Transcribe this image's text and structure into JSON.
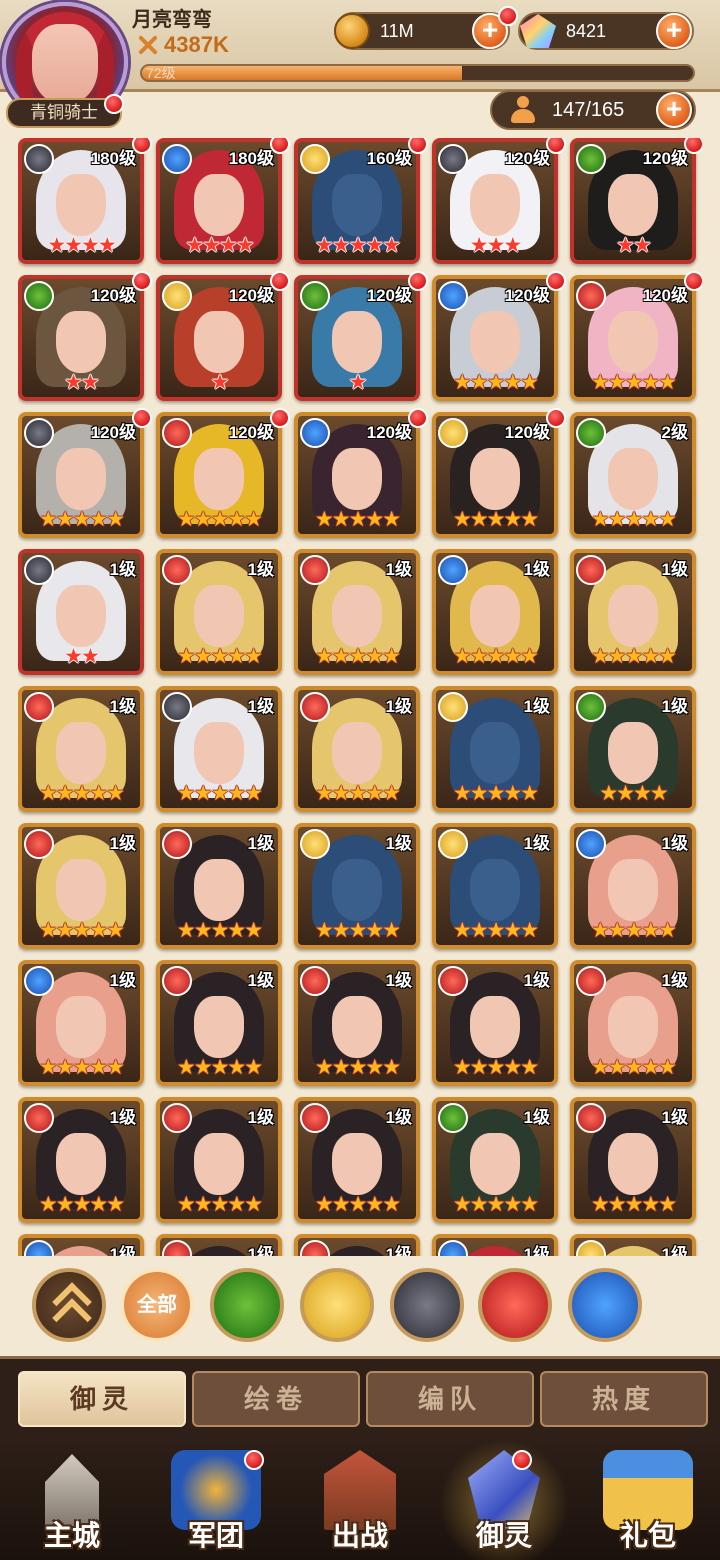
{
  "player": {
    "name": "月亮弯弯",
    "power": "4387K",
    "level_text": "72级",
    "level_progress": 0.58,
    "rank": "青铜骑士"
  },
  "resources": {
    "gold": "11M",
    "gems": "8421",
    "roster": "147/165"
  },
  "heroes": [
    {
      "level": "180级",
      "element": "dark",
      "stars": 4,
      "frame": "red",
      "hair": "#e8e4ec",
      "dot": true
    },
    {
      "level": "180级",
      "element": "water",
      "stars": 4,
      "frame": "red",
      "hair": "#c02835",
      "dot": true
    },
    {
      "level": "160级",
      "element": "holy",
      "stars": 5,
      "frame": "red",
      "hair": "#2c4d78",
      "dot": true
    },
    {
      "level": "120级",
      "element": "dark",
      "stars": 3,
      "frame": "red",
      "hair": "#f2f2f6",
      "dot": true
    },
    {
      "level": "120级",
      "element": "wind",
      "stars": 2,
      "frame": "red",
      "hair": "#1f1c1c",
      "dot": true
    },
    {
      "level": "120级",
      "element": "wind",
      "stars": 2,
      "frame": "red",
      "hair": "#6c5640",
      "dot": true
    },
    {
      "level": "120级",
      "element": "holy",
      "stars": 1,
      "frame": "red",
      "hair": "#b8402a",
      "dot": true
    },
    {
      "level": "120级",
      "element": "wind",
      "stars": 1,
      "frame": "red",
      "hair": "#3a7aa8",
      "dot": true
    },
    {
      "level": "120级",
      "element": "water",
      "stars": 5,
      "frame": "gold",
      "hair": "#c8ccd4",
      "dot": true
    },
    {
      "level": "120级",
      "element": "fire",
      "stars": 5,
      "frame": "gold",
      "hair": "#f0b4c4",
      "dot": true
    },
    {
      "level": "120级",
      "element": "dark",
      "stars": 5,
      "frame": "gold",
      "hair": "#b4b0ac",
      "dot": true
    },
    {
      "level": "120级",
      "element": "fire",
      "stars": 5,
      "frame": "gold",
      "hair": "#e6b828",
      "dot": true
    },
    {
      "level": "120级",
      "element": "water",
      "stars": 5,
      "frame": "gold",
      "hair": "#3a2430",
      "dot": true
    },
    {
      "level": "120级",
      "element": "holy",
      "stars": 5,
      "frame": "gold",
      "hair": "#2a2220",
      "dot": true
    },
    {
      "level": "2级",
      "element": "wind",
      "stars": 5,
      "frame": "gold",
      "hair": "#e4e4e8",
      "dot": false
    },
    {
      "level": "1级",
      "element": "dark",
      "stars": 2,
      "frame": "red",
      "hair": "#e8e8ec",
      "dot": false
    },
    {
      "level": "1级",
      "element": "fire",
      "stars": 5,
      "frame": "gold",
      "hair": "#e6c66c",
      "dot": false
    },
    {
      "level": "1级",
      "element": "fire",
      "stars": 5,
      "frame": "gold",
      "hair": "#e6c66c",
      "dot": false
    },
    {
      "level": "1级",
      "element": "water",
      "stars": 5,
      "frame": "gold",
      "hair": "#e0b84c",
      "dot": false
    },
    {
      "level": "1级",
      "element": "fire",
      "stars": 5,
      "frame": "gold",
      "hair": "#e6c66c",
      "dot": false
    },
    {
      "level": "1级",
      "element": "fire",
      "stars": 5,
      "frame": "gold",
      "hair": "#e6c66c",
      "dot": false
    },
    {
      "level": "1级",
      "element": "dark",
      "stars": 5,
      "frame": "gold",
      "hair": "#e8e8ec",
      "dot": false
    },
    {
      "level": "1级",
      "element": "fire",
      "stars": 5,
      "frame": "gold",
      "hair": "#e6c66c",
      "dot": false
    },
    {
      "level": "1级",
      "element": "holy",
      "stars": 5,
      "frame": "gold",
      "hair": "#2c4d78",
      "dot": false
    },
    {
      "level": "1级",
      "element": "wind",
      "stars": 4,
      "frame": "gold",
      "hair": "#2a3a2c",
      "dot": false
    },
    {
      "level": "1级",
      "element": "fire",
      "stars": 5,
      "frame": "gold",
      "hair": "#e6c66c",
      "dot": false
    },
    {
      "level": "1级",
      "element": "fire",
      "stars": 5,
      "frame": "gold",
      "hair": "#2a2224",
      "dot": false
    },
    {
      "level": "1级",
      "element": "holy",
      "stars": 5,
      "frame": "gold",
      "hair": "#2c4d78",
      "dot": false
    },
    {
      "level": "1级",
      "element": "holy",
      "stars": 5,
      "frame": "gold",
      "hair": "#2c4d78",
      "dot": false
    },
    {
      "level": "1级",
      "element": "water",
      "stars": 5,
      "frame": "gold",
      "hair": "#e8a08c",
      "dot": false
    },
    {
      "level": "1级",
      "element": "water",
      "stars": 5,
      "frame": "gold",
      "hair": "#e8a08c",
      "dot": false
    },
    {
      "level": "1级",
      "element": "fire",
      "stars": 5,
      "frame": "gold",
      "hair": "#2a2224",
      "dot": false
    },
    {
      "level": "1级",
      "element": "fire",
      "stars": 5,
      "frame": "gold",
      "hair": "#2a2224",
      "dot": false
    },
    {
      "level": "1级",
      "element": "fire",
      "stars": 5,
      "frame": "gold",
      "hair": "#2a2224",
      "dot": false
    },
    {
      "level": "1级",
      "element": "fire",
      "stars": 5,
      "frame": "gold",
      "hair": "#e8a08c",
      "dot": false
    },
    {
      "level": "1级",
      "element": "fire",
      "stars": 5,
      "frame": "gold",
      "hair": "#2a2224",
      "dot": false
    },
    {
      "level": "1级",
      "element": "fire",
      "stars": 5,
      "frame": "gold",
      "hair": "#2a2224",
      "dot": false
    },
    {
      "level": "1级",
      "element": "fire",
      "stars": 5,
      "frame": "gold",
      "hair": "#2a2224",
      "dot": false
    },
    {
      "level": "1级",
      "element": "wind",
      "stars": 5,
      "frame": "gold",
      "hair": "#2a3a2c",
      "dot": false
    },
    {
      "level": "1级",
      "element": "fire",
      "stars": 5,
      "frame": "gold",
      "hair": "#2a2224",
      "dot": false
    },
    {
      "level": "1级",
      "element": "water",
      "stars": 5,
      "frame": "gold",
      "hair": "#e8a08c",
      "dot": false
    },
    {
      "level": "1级",
      "element": "fire",
      "stars": 5,
      "frame": "gold",
      "hair": "#2a2224",
      "dot": false
    },
    {
      "level": "1级",
      "element": "fire",
      "stars": 5,
      "frame": "gold",
      "hair": "#2a2224",
      "dot": false
    },
    {
      "level": "1级",
      "element": "water",
      "stars": 5,
      "frame": "gold",
      "hair": "#c02835",
      "dot": false
    },
    {
      "level": "1级",
      "element": "holy",
      "stars": 5,
      "frame": "gold",
      "hair": "#e6c66c",
      "dot": false
    }
  ],
  "filters": {
    "all_label": "全部",
    "elements": [
      "wind",
      "holy",
      "dark",
      "fire",
      "water"
    ]
  },
  "subtabs": [
    "御灵",
    "绘卷",
    "编队",
    "热度"
  ],
  "active_subtab": 0,
  "nav": [
    {
      "label": "主城",
      "icon": "city-icon"
    },
    {
      "label": "军团",
      "icon": "legion-icon"
    },
    {
      "label": "出战",
      "icon": "battle-icon"
    },
    {
      "label": "御灵",
      "icon": "spirit-icon"
    },
    {
      "label": "礼包",
      "icon": "gift-icon"
    }
  ],
  "active_nav": 3,
  "colors": {
    "accent": "#d9782a",
    "frame_gold": "#d08c2c",
    "frame_red": "#c1332a",
    "badge_red": "#d81b1b"
  }
}
